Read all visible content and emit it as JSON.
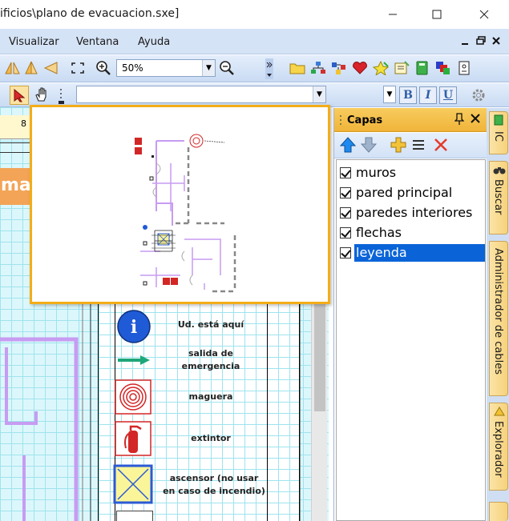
{
  "window": {
    "title": "ificios\\plano de evacuacion.sxe]"
  },
  "menu": {
    "items": [
      "Visualizar",
      "Ventana",
      "Ayuda"
    ]
  },
  "toolbar": {
    "zoom_value": "50%"
  },
  "format_buttons": {
    "bold": "B",
    "italic": "I",
    "underline": "U"
  },
  "canvas": {
    "ruler_mark": "8",
    "side_text": "ma",
    "legend": [
      {
        "label": "Ud. está aquí",
        "symbol": "info"
      },
      {
        "label": "salida de emergencia",
        "symbol": "arrow"
      },
      {
        "label": "maguera",
        "symbol": "hose"
      },
      {
        "label": "extintor",
        "symbol": "extinguisher"
      },
      {
        "label": "ascensor (no usar en caso de incendio)",
        "symbol": "elevator"
      }
    ],
    "info_glyph": "i"
  },
  "layers_panel": {
    "title": "Capas",
    "layers": [
      {
        "name": "muros",
        "checked": true,
        "selected": false
      },
      {
        "name": "pared principal",
        "checked": true,
        "selected": false
      },
      {
        "name": "paredes interiores",
        "checked": true,
        "selected": false
      },
      {
        "name": "flechas",
        "checked": true,
        "selected": false
      },
      {
        "name": "leyenda",
        "checked": true,
        "selected": true
      }
    ]
  },
  "side_tabs": [
    "IC",
    "Buscar",
    "Administrador de cables",
    "Explorador"
  ],
  "colors": {
    "accent": "#f3ad19",
    "menu_bg": "#d5e3f6",
    "selection": "#0a64d8",
    "grid": "#9fe3ee",
    "wall": "#c79cf2"
  }
}
